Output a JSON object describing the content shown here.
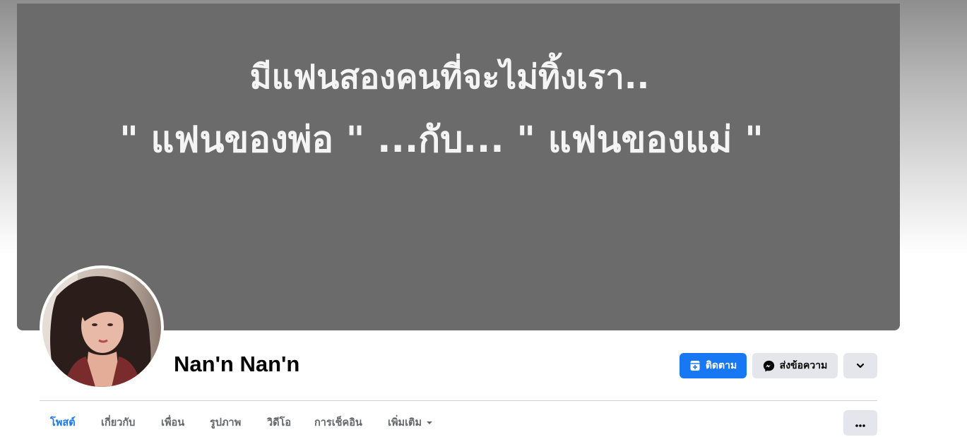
{
  "cover": {
    "line1": "มีแฟนสองคนที่จะไม่ทิ้งเรา..",
    "line2": "\" แฟนของพ่อ \" ...กับ... \" แฟนของแม่ \"",
    "background": "#6b6b6b"
  },
  "profile": {
    "name": "Nan'n Nan'n"
  },
  "actions": {
    "follow_label": "ติดตาม",
    "message_label": "ส่งข้อความ"
  },
  "tabs": [
    {
      "label": "โพสต์",
      "active": true
    },
    {
      "label": "เกี่ยวกับ",
      "active": false
    },
    {
      "label": "เพื่อน",
      "active": false
    },
    {
      "label": "รูปภาพ",
      "active": false
    },
    {
      "label": "วิดีโอ",
      "active": false
    },
    {
      "label": "การเช็คอิน",
      "active": false
    },
    {
      "label": "เพิ่มเติม",
      "active": false
    }
  ],
  "colors": {
    "accent": "#1877f2",
    "secondary_button": "#e4e6eb",
    "tab_inactive": "#65676b"
  },
  "icons": {
    "follow": "follow-add-icon",
    "message": "messenger-icon",
    "dropdown": "chevron-down-icon",
    "tab_more": "caret-down-icon",
    "more_options": "ellipsis-icon"
  }
}
